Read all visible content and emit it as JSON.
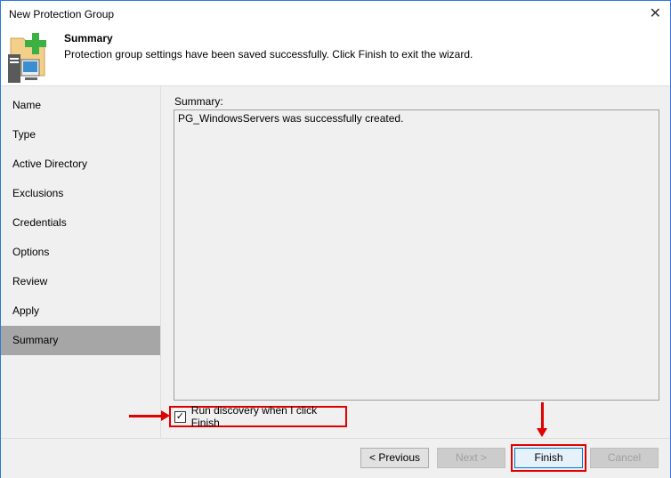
{
  "window": {
    "title": "New Protection Group",
    "close": "✕"
  },
  "header": {
    "title": "Summary",
    "subtitle": "Protection group settings have been saved successfully. Click Finish to exit the wizard."
  },
  "nav": {
    "items": [
      "Name",
      "Type",
      "Active Directory",
      "Exclusions",
      "Credentials",
      "Options",
      "Review",
      "Apply",
      "Summary"
    ]
  },
  "summary": {
    "label": "Summary:",
    "text": "PG_WindowsServers was successfully created."
  },
  "checkbox": {
    "label": "Run discovery when I click Finish",
    "checked": true,
    "mark": "✓"
  },
  "buttons": {
    "previous": "< Previous",
    "next": "Next >",
    "finish": "Finish",
    "cancel": "Cancel"
  }
}
